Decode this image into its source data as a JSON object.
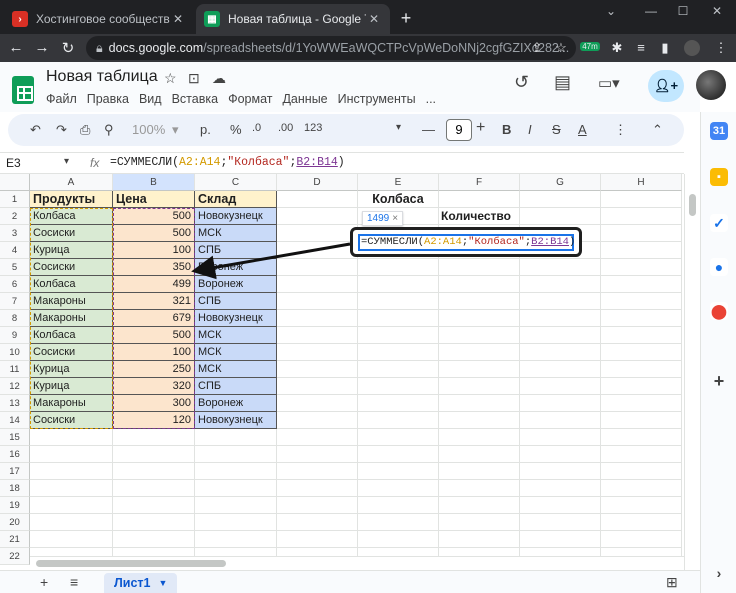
{
  "browser": {
    "tabs": [
      {
        "title": "Хостинговое сообщество «Time",
        "active": false
      },
      {
        "title": "Новая таблица - Google Таблиц",
        "active": true
      }
    ],
    "url_host": "docs.google.com",
    "url_path": "/spreadsheets/d/1YoWWEaWQCTPcVpWeDoNNj2cgfGZIXc282...",
    "ext_badge": "47m"
  },
  "doc": {
    "title": "Новая таблица",
    "menu": [
      "Файл",
      "Правка",
      "Вид",
      "Вставка",
      "Формат",
      "Данные",
      "Инструменты",
      "..."
    ]
  },
  "toolbar": {
    "zoom": "100%",
    "currency": "р.",
    "percent": "%",
    "dec_decrease": ".0",
    "dec_increase": ".00",
    "number_format": "123",
    "font_size": "9",
    "bold": "B",
    "italic": "I",
    "underline": "A"
  },
  "formula_bar": {
    "cell_ref": "E3",
    "formula_prefix": "=СУММЕСЛИ(",
    "arg1": "A2:A14",
    "sep1": ";",
    "arg2": "\"Колбаса\"",
    "sep2": ";",
    "arg3": "B2:B14",
    "suffix": ")"
  },
  "columns": [
    "A",
    "B",
    "C",
    "D",
    "E",
    "F",
    "G",
    "H"
  ],
  "rows": [
    {
      "num": "1",
      "a": "Продукты",
      "b": "Цена",
      "c": "Склад",
      "e": "Колбаса"
    },
    {
      "num": "2",
      "a": "Колбаса",
      "b": "500",
      "c": "Новокузнецк",
      "f": "Количество"
    },
    {
      "num": "3",
      "a": "Сосиски",
      "b": "500",
      "c": "МСК"
    },
    {
      "num": "4",
      "a": "Курица",
      "b": "100",
      "c": "СПБ"
    },
    {
      "num": "5",
      "a": "Сосиски",
      "b": "350",
      "c": "Воронеж"
    },
    {
      "num": "6",
      "a": "Колбаса",
      "b": "499",
      "c": "Воронеж"
    },
    {
      "num": "7",
      "a": "Макароны",
      "b": "321",
      "c": "СПБ"
    },
    {
      "num": "8",
      "a": "Макароны",
      "b": "679",
      "c": "Новокузнецк"
    },
    {
      "num": "9",
      "a": "Колбаса",
      "b": "500",
      "c": "МСК"
    },
    {
      "num": "10",
      "a": "Сосиски",
      "b": "100",
      "c": "МСК"
    },
    {
      "num": "11",
      "a": "Курица",
      "b": "250",
      "c": "МСК"
    },
    {
      "num": "12",
      "a": "Курица",
      "b": "320",
      "c": "СПБ"
    },
    {
      "num": "13",
      "a": "Макароны",
      "b": "300",
      "c": "Воронеж"
    },
    {
      "num": "14",
      "a": "Сосиски",
      "b": "120",
      "c": "Новокузнецк"
    },
    {
      "num": "15"
    },
    {
      "num": "16"
    },
    {
      "num": "17"
    },
    {
      "num": "18"
    },
    {
      "num": "19"
    },
    {
      "num": "20"
    },
    {
      "num": "21"
    },
    {
      "num": "22"
    }
  ],
  "edit_popup": {
    "tooltip_value": "1499",
    "tooltip_close": "×",
    "formula_prefix": "=СУММЕСЛИ(",
    "arg1": "A2:A14",
    "sep1": ";",
    "arg2": "\"Колбаса\"",
    "sep2": ";",
    "arg3": "B2:B14",
    "suffix": ")"
  },
  "sheet_tab": {
    "label": "Лист1"
  },
  "colors": {
    "green_fill": "#d9ead3",
    "orange_fill": "#fce5cd",
    "blue_fill": "#c9daf8",
    "header_fill": "#fff2cc",
    "sheets_green": "#0f9d58"
  }
}
